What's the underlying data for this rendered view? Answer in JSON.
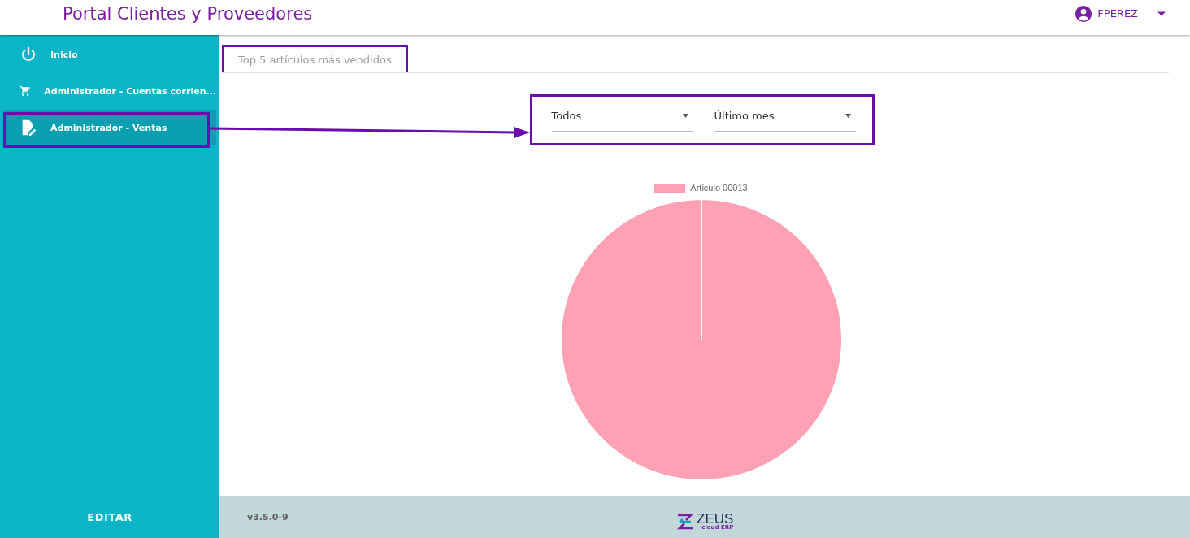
{
  "header": {
    "title": "Portal Clientes y Proveedores",
    "user": "FPEREZ"
  },
  "sidebar": {
    "items": [
      {
        "kind": "power",
        "label": "Inicio",
        "selected": false
      },
      {
        "kind": "cart",
        "label": "Administrador - Cuentas corrien...",
        "selected": false
      },
      {
        "kind": "document",
        "label": "Administrador - Ventas",
        "selected": true
      }
    ],
    "edit_button": "EDITAR"
  },
  "tabs": [
    {
      "label": "Top 5 artículos más vendidos",
      "selected": false
    }
  ],
  "filters": [
    {
      "value": "Todos"
    },
    {
      "value": "Último mes"
    }
  ],
  "chart": {
    "legend": [
      {
        "label": "Articulo 00013",
        "color": "#ffa1b5"
      }
    ]
  },
  "footer": {
    "version": "v3.5.0-9",
    "logo": {
      "name": "ZEUS",
      "tagline": "cloud ERP"
    }
  }
}
